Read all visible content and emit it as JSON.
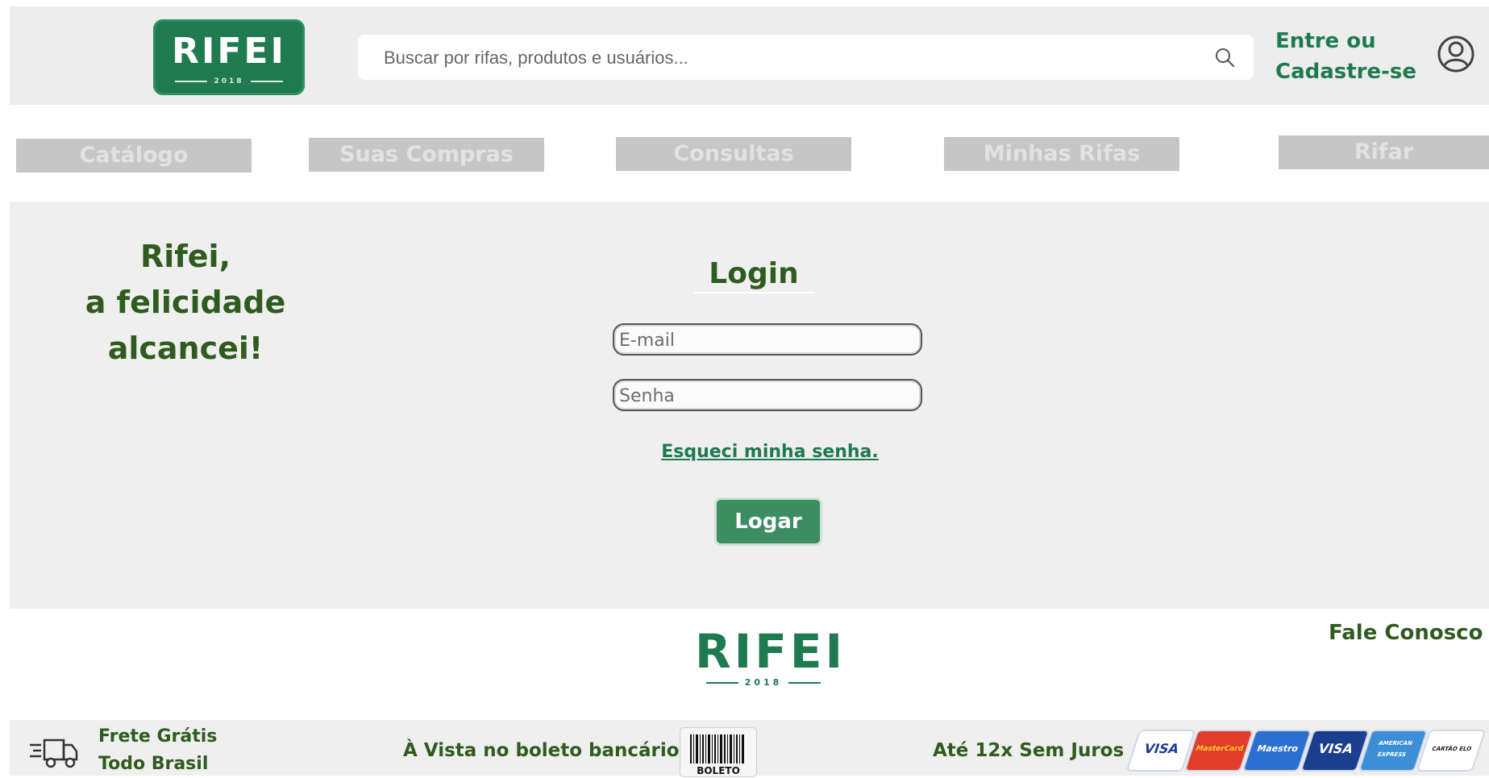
{
  "header": {
    "logo": {
      "word": "RIFEI",
      "year": "2018"
    },
    "search": {
      "placeholder": "Buscar por rifas, produtos e usuários..."
    },
    "login_link": {
      "line1": "Entre ou",
      "line2": "Cadastre-se"
    }
  },
  "nav": {
    "items": [
      {
        "label": "Catálogo"
      },
      {
        "label": "Suas Compras"
      },
      {
        "label": "Consultas"
      },
      {
        "label": "Minhas Rifas"
      },
      {
        "label": "Rifar"
      }
    ]
  },
  "main": {
    "slogan": {
      "line1": "Rifei,",
      "line2": "a felicidade",
      "line3": "alcancei!"
    },
    "login": {
      "title": "Login",
      "email_placeholder": "E-mail",
      "password_placeholder": "Senha",
      "forgot_label": "Esqueci minha senha.",
      "submit_label": "Logar"
    }
  },
  "footer": {
    "logo": {
      "word": "RIFEI",
      "year": "2018"
    },
    "contact_label": "Fale Conosco",
    "shipping": {
      "line1": "Frete Grátis",
      "line2": "Todo Brasil"
    },
    "boleto_text": "À Vista no boleto bancário",
    "boleto_badge": "BOLETO",
    "installments_text": "Até 12x Sem Juros",
    "cards": [
      {
        "label": "VISA",
        "color": "#ffffff",
        "text": "#1a3f8f"
      },
      {
        "label": "MasterCard",
        "color": "#e23c2c",
        "text": "#ffcf2e"
      },
      {
        "label": "Maestro",
        "color": "#2b6fd1",
        "text": "#ffffff"
      },
      {
        "label": "VISA",
        "color": "#1a3f8f",
        "text": "#ffffff"
      },
      {
        "label": "AMERICAN EXPRESS",
        "color": "#3c8fd6",
        "text": "#ffffff"
      },
      {
        "label": "CARTÃO ELO",
        "color": "#ffffff",
        "text": "#222222"
      }
    ]
  },
  "colors": {
    "brand_green": "#1f7a4f",
    "text_dark_green": "#2f5b1f",
    "nav_gray": "#c6c6c6",
    "panel_gray": "#efefef"
  }
}
